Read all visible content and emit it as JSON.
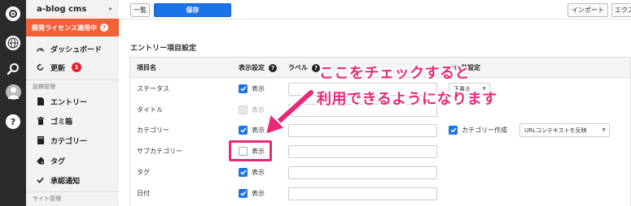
{
  "sidebar": {
    "brand": "a-blog cms",
    "license_banner": "開発ライセンス適用中",
    "items": [
      {
        "label": "ダッシュボード",
        "icon": "dashboard-icon"
      },
      {
        "label": "更新",
        "icon": "refresh-icon",
        "badge": "1"
      },
      {
        "label": "エントリー",
        "icon": "document-icon"
      },
      {
        "label": "ゴミ箱",
        "icon": "trash-icon"
      },
      {
        "label": "カテゴリー",
        "icon": "folder-icon"
      },
      {
        "label": "タグ",
        "icon": "tag-icon"
      },
      {
        "label": "承認通知",
        "icon": "check-icon"
      }
    ],
    "section_posts": "投稿管理",
    "section_site": "サイト管理"
  },
  "rail_icons": [
    "logo-icon",
    "globe-icon",
    "search-icon",
    "user-avatar-icon",
    "help-icon"
  ],
  "toolbar": {
    "list_label": "一覧",
    "save_label": "保存",
    "import_label": "インポート",
    "export_label": "エクス"
  },
  "section_title": "エントリー項目設定",
  "table": {
    "headers": {
      "name": "項目名",
      "display": "表示設定",
      "label": "ラベル",
      "other": "その他設定"
    },
    "display_text": "表示",
    "rows": [
      {
        "name": "ステータス",
        "checked": true,
        "disabled": false
      },
      {
        "name": "タイトル",
        "checked": false,
        "disabled": true
      },
      {
        "name": "カテゴリー",
        "checked": true,
        "disabled": false
      },
      {
        "name": "サブカテゴリー",
        "checked": false,
        "disabled": false
      },
      {
        "name": "タグ",
        "checked": true,
        "disabled": false
      },
      {
        "name": "日付",
        "checked": true,
        "disabled": false
      }
    ],
    "status_select": "下書き",
    "category_create_label": "カテゴリー作成",
    "url_context_select": "URLコンテキストを反映"
  },
  "annotation": {
    "line1": "ここをチェックすると",
    "line2": "利用できるようになります",
    "color": "#e8297a"
  }
}
